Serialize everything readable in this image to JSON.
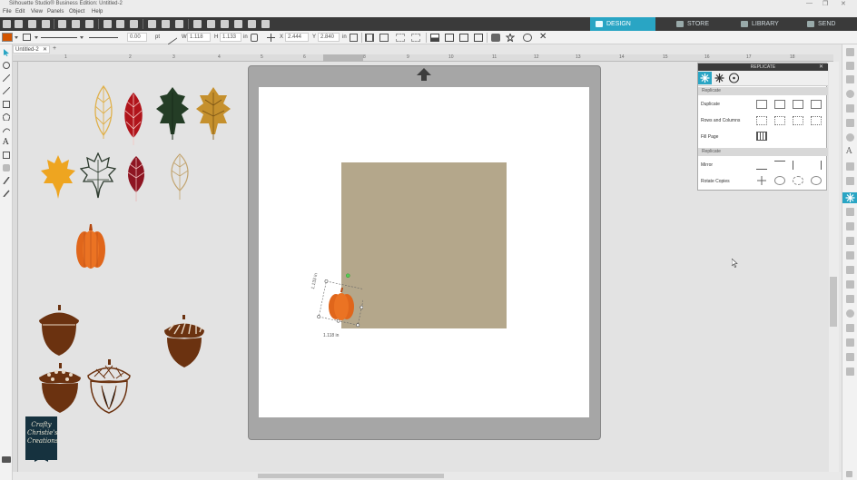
{
  "app": {
    "title": "Silhouette Studio® Business Edition: Untitled-2",
    "window_controls": [
      "—",
      "❐",
      "✕"
    ]
  },
  "menu": [
    "File",
    "Edit",
    "View",
    "Panels",
    "Object",
    "Help"
  ],
  "nav_tabs": [
    {
      "label": "DESIGN",
      "active": true
    },
    {
      "label": "STORE",
      "active": false
    },
    {
      "label": "LIBRARY",
      "active": false
    },
    {
      "label": "SEND",
      "active": false
    }
  ],
  "toolbar2": {
    "line_width": "0.00",
    "line_unit": "pt",
    "width_label": "W",
    "width_value": "1.118",
    "height_label": "H",
    "height_value": "1.133",
    "size_unit": "in",
    "x_label": "X",
    "x_value": "2.444",
    "y_label": "Y",
    "y_value": "2.840",
    "pos_unit": "in"
  },
  "document_tab": {
    "label": "Untitled-2",
    "add_symbol": "+"
  },
  "ruler_ticks": [
    "1",
    "2",
    "3",
    "4",
    "5",
    "6",
    "7",
    "8",
    "9",
    "10",
    "11",
    "12",
    "13",
    "14",
    "15",
    "16",
    "17",
    "18"
  ],
  "selection": {
    "size_label": "1.118 in",
    "side_label": "1.133 in"
  },
  "replicate_panel": {
    "title": "REPLICATE",
    "section1": "Replicate",
    "rows1": [
      "Duplicate",
      "Rows and Columns",
      "Fill Page"
    ],
    "section2": "Replicate",
    "rows2": [
      "Mirror",
      "Rotate Copies"
    ]
  },
  "colors": {
    "accent": "#29a5c4",
    "fill_swatch": "#d35400",
    "tan_rect": "#b4a78b",
    "pumpkin": "#e0661b",
    "acorn": "#6b3210"
  },
  "logo": {
    "text": "Crafty Christie's Creations"
  }
}
